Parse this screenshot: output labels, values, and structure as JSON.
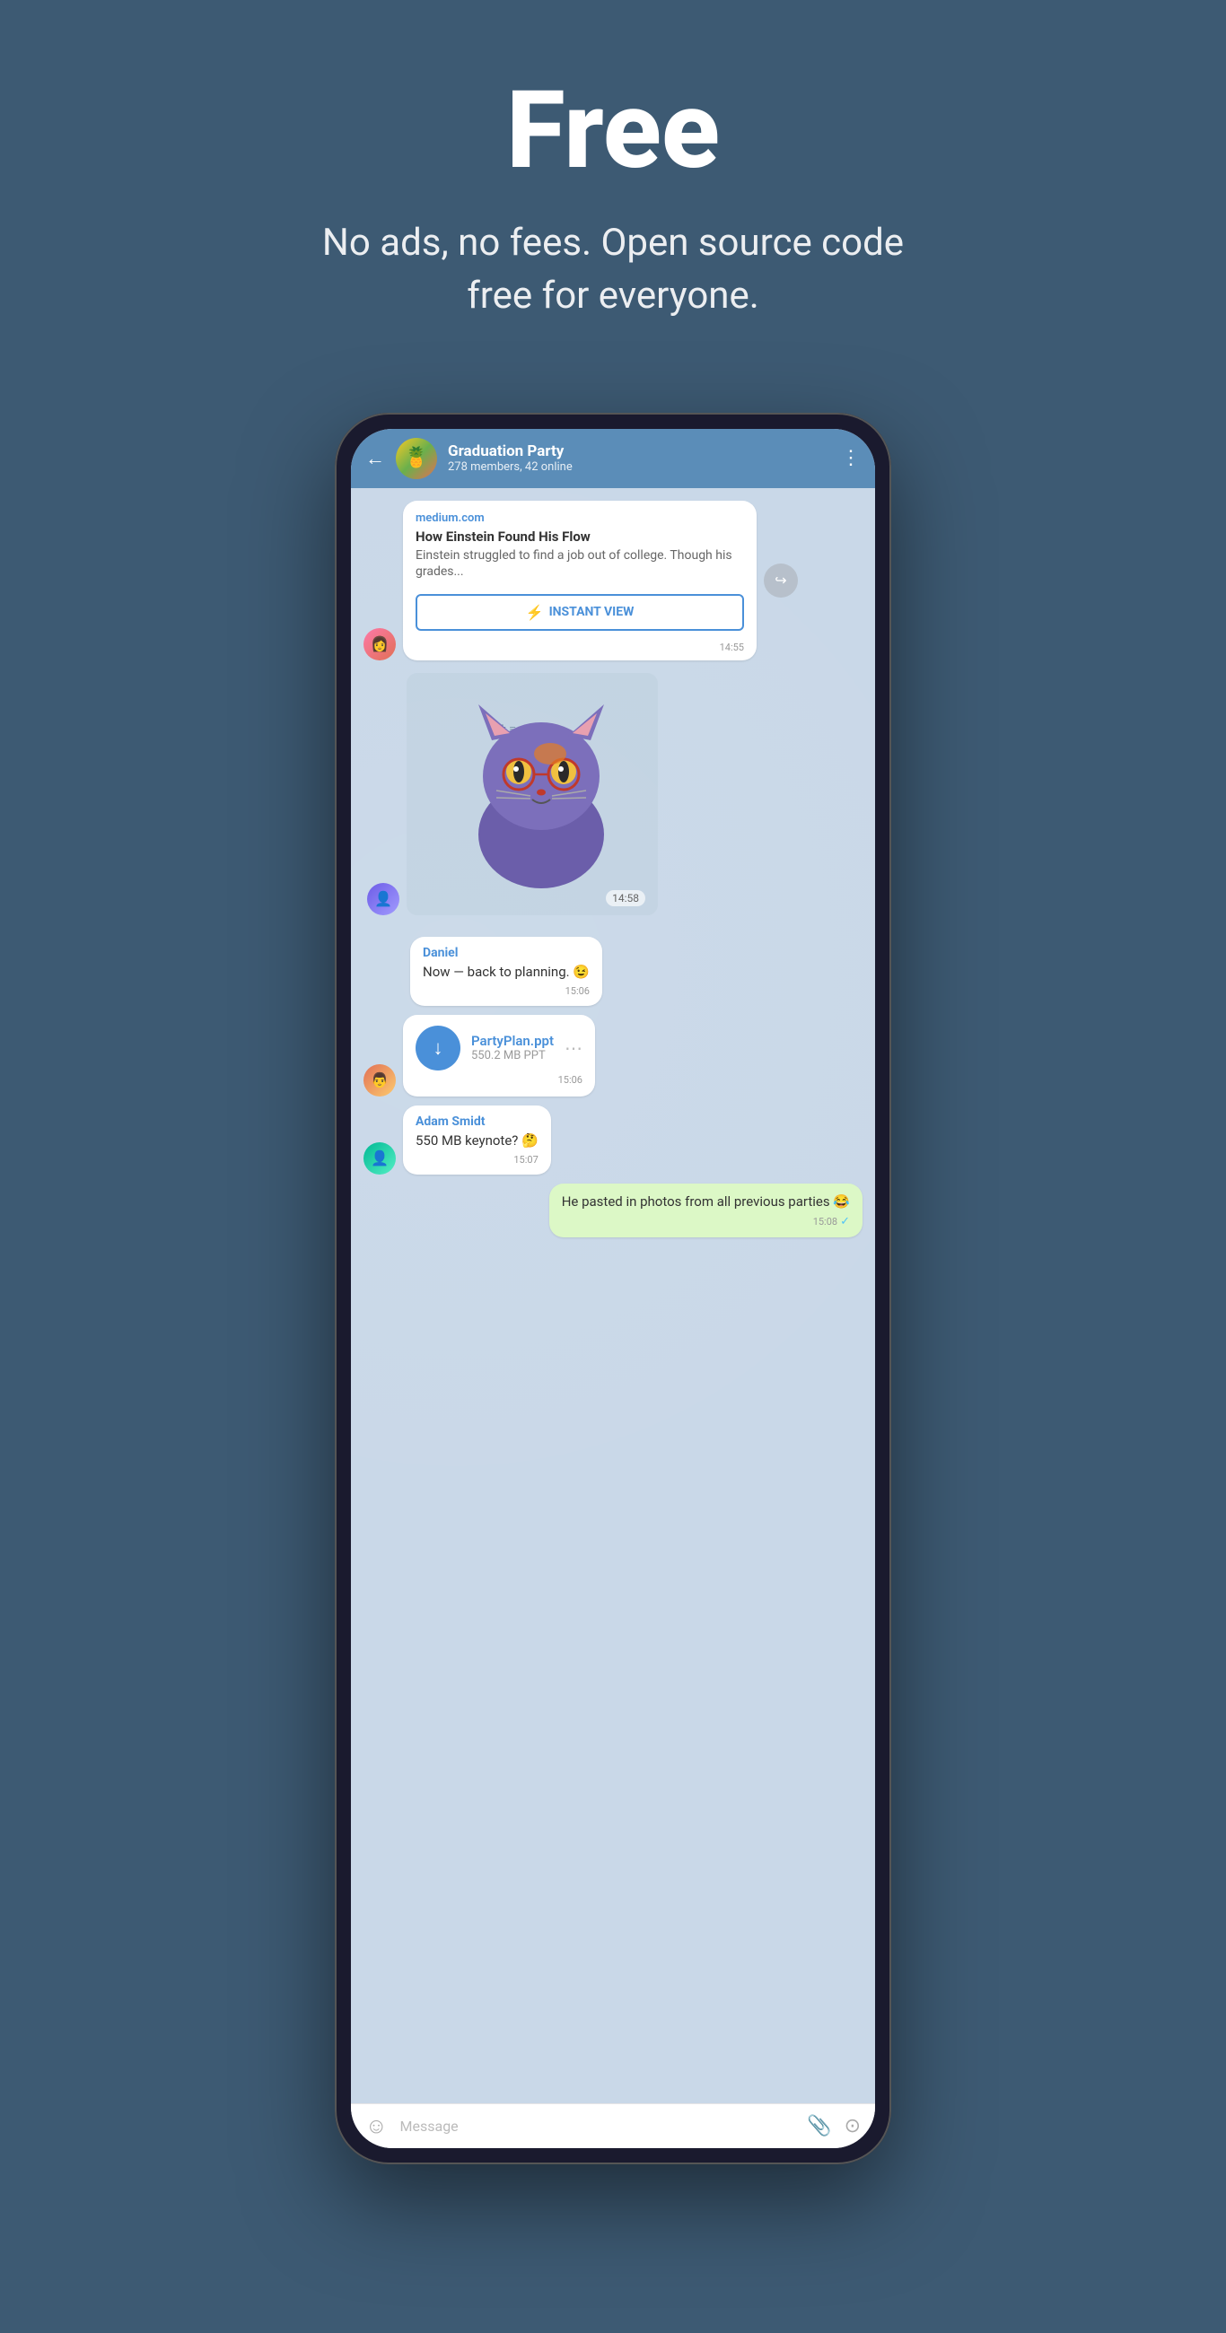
{
  "hero": {
    "title": "Free",
    "subtitle": "No ads, no fees. Open source code free for everyone."
  },
  "phone": {
    "chat": {
      "name": "Graduation Party",
      "members": "278 members, 42 online",
      "back_label": "←",
      "more_label": "⋮"
    },
    "messages": [
      {
        "id": "article-msg",
        "type": "article",
        "source": "medium.com",
        "title": "How Einstein Found His Flow",
        "snippet": "Einstein struggled to find a job out of college. Though his grades...",
        "instant_view_label": "INSTANT VIEW",
        "time": "14:55"
      },
      {
        "id": "sticker-msg",
        "type": "sticker",
        "time": "14:58"
      },
      {
        "id": "daniel-msg",
        "type": "text",
        "sender": "Daniel",
        "text": "Now — back to planning. 😉",
        "time": "15:06"
      },
      {
        "id": "file-msg",
        "type": "file",
        "file_name": "PartyPlan.ppt",
        "file_size": "550.2 MB PPT",
        "time": "15:06"
      },
      {
        "id": "adam-msg",
        "type": "text",
        "sender": "Adam Smidt",
        "text": "550 MB keynote? 🤔",
        "time": "15:07"
      },
      {
        "id": "outgoing-msg",
        "type": "outgoing",
        "text": "He pasted in photos from all previous parties 😂",
        "time": "15:08",
        "check": "✓"
      }
    ],
    "input": {
      "placeholder": "Message",
      "emoji_icon": "☺",
      "attach_icon": "📎",
      "camera_icon": "⊙"
    }
  },
  "colors": {
    "header_bg": "#5b8db8",
    "chat_bg": "#c9d8e8",
    "outgoing_bubble": "#dcf8c6",
    "page_bg": "#3d5a73",
    "sender_color_daniel": "#4a90d9",
    "sender_color_adam": "#4a90d9",
    "iv_button_color": "#4a90d9"
  }
}
